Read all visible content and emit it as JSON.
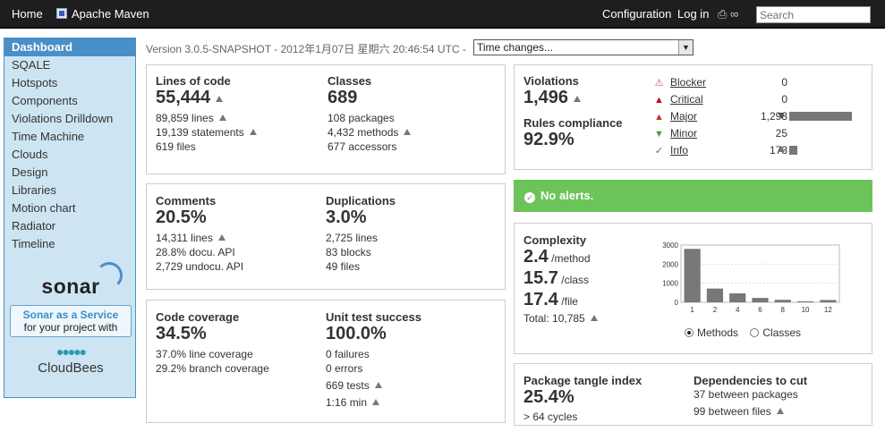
{
  "topbar": {
    "home": "Home",
    "project": "Apache Maven",
    "configuration": "Configuration",
    "login": "Log in",
    "search_placeholder": "Search"
  },
  "sidebar": {
    "items": [
      {
        "label": "Dashboard",
        "active": true
      },
      {
        "label": "SQALE"
      },
      {
        "label": "Hotspots"
      },
      {
        "label": "Components"
      },
      {
        "label": "Violations Drilldown"
      },
      {
        "label": "Time Machine"
      },
      {
        "label": "Clouds"
      },
      {
        "label": "Design"
      },
      {
        "label": "Libraries"
      },
      {
        "label": "Motion chart"
      },
      {
        "label": "Radiator"
      },
      {
        "label": "Timeline"
      }
    ],
    "logo": "sonar",
    "promo_line1": "Sonar as a Service",
    "promo_line2": "for your project with",
    "cloudbees": "CloudBees"
  },
  "header": {
    "version": "Version 3.0.5-SNAPSHOT - 2012年1月07日 星期六 20:46:54 UTC -",
    "time_select": "Time changes..."
  },
  "size": {
    "lines_label": "Lines of code",
    "lines_value": "55,444",
    "lines": "89,859 lines",
    "statements": "19,139 statements",
    "files": "619 files",
    "classes_label": "Classes",
    "classes_value": "689",
    "packages": "108 packages",
    "methods": "4,432 methods",
    "accessors": "677 accessors"
  },
  "comments": {
    "label": "Comments",
    "value": "20.5%",
    "lines": "14,311 lines",
    "docu": "28.8% docu. API",
    "undocu": "2,729 undocu. API",
    "dup_label": "Duplications",
    "dup_value": "3.0%",
    "dup_lines": "2,725 lines",
    "dup_blocks": "83 blocks",
    "dup_files": "49 files"
  },
  "coverage": {
    "label": "Code coverage",
    "value": "34.5%",
    "line": "37.0% line coverage",
    "branch": "29.2% branch coverage",
    "ut_label": "Unit test success",
    "ut_value": "100.0%",
    "failures": "0 failures",
    "errors": "0 errors",
    "tests": "669 tests",
    "duration": "1:16 min"
  },
  "violations": {
    "label": "Violations",
    "value": "1,496",
    "rc_label": "Rules compliance",
    "rc_value": "92.9%",
    "severities": [
      {
        "name": "Blocker",
        "count": "0",
        "color": "#d9534f",
        "share": 0
      },
      {
        "name": "Critical",
        "count": "0",
        "color": "#b5121b",
        "share": 0
      },
      {
        "name": "Major",
        "count": "1,298",
        "color": "#c0392b",
        "share": 1.0
      },
      {
        "name": "Minor",
        "count": "25",
        "color": "#4aa33a",
        "share": 0
      },
      {
        "name": "Info",
        "count": "173",
        "color": "#3a8a2a",
        "share": 0.13
      }
    ]
  },
  "alerts": {
    "text": "No alerts."
  },
  "complexity": {
    "label": "Complexity",
    "per_method": "2.4",
    "per_method_unit": "/method",
    "per_class": "15.7",
    "per_class_unit": "/class",
    "per_file": "17.4",
    "per_file_unit": "/file",
    "total": "Total:  10,785",
    "radio_methods": "Methods",
    "radio_classes": "Classes"
  },
  "chart_data": {
    "type": "bar",
    "categories": [
      "1",
      "2",
      "4",
      "6",
      "8",
      "10",
      "12"
    ],
    "values": [
      2800,
      720,
      470,
      230,
      130,
      50,
      120
    ],
    "ylim": [
      0,
      3000
    ],
    "yticks": [
      "0",
      "1000",
      "2000",
      "3000"
    ],
    "grid": true
  },
  "tangle": {
    "label": "Package tangle index",
    "value": "25.4%",
    "cycles": "> 64 cycles",
    "dep_label": "Dependencies to cut",
    "between_packages": "37 between packages",
    "between_files": "99 between files"
  }
}
